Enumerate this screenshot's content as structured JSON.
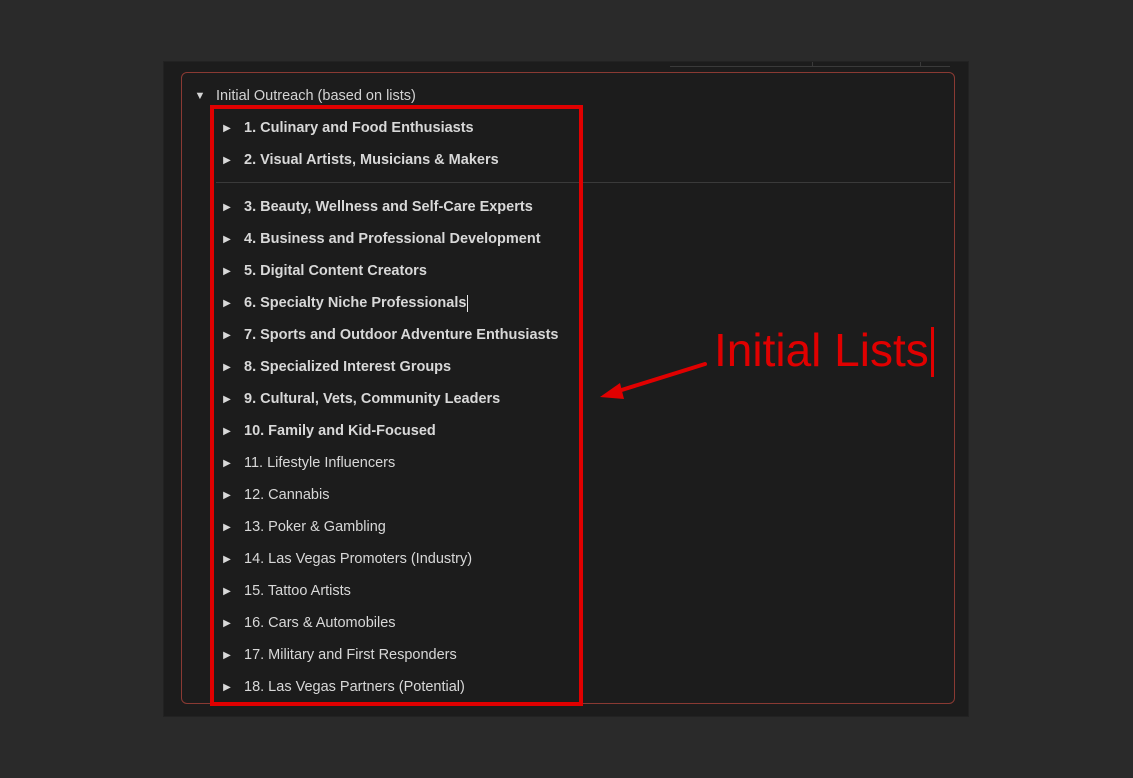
{
  "toggle": {
    "title": "Initial Outreach (based on lists)"
  },
  "lists": [
    {
      "label": "1. Culinary and Food Enthusiasts",
      "bold": true
    },
    {
      "label": "2. Visual Artists, Musicians & Makers",
      "bold": true
    },
    {
      "label": "3. Beauty, Wellness and Self-Care Experts",
      "bold": true
    },
    {
      "label": "4. Business and Professional Development",
      "bold": true
    },
    {
      "label": "5. Digital Content Creators",
      "bold": true
    },
    {
      "label": "6. Specialty Niche Professionals",
      "bold": true
    },
    {
      "label": "7. Sports and Outdoor Adventure Enthusiasts",
      "bold": true
    },
    {
      "label": "8. Specialized Interest Groups",
      "bold": true
    },
    {
      "label": "9. Cultural, Vets, Community Leaders",
      "bold": true
    },
    {
      "label": "10. Family and Kid-Focused",
      "bold": true
    },
    {
      "label": "11. Lifestyle Influencers",
      "bold": false
    },
    {
      "label": "12. Cannabis",
      "bold": false
    },
    {
      "label": "13. Poker & Gambling",
      "bold": false
    },
    {
      "label": "14. Las Vegas Promoters (Industry)",
      "bold": false
    },
    {
      "label": "15. Tattoo Artists",
      "bold": false
    },
    {
      "label": "16. Cars & Automobiles",
      "bold": false
    },
    {
      "label": "17. Military and First Responders",
      "bold": false
    },
    {
      "label": "18. Las Vegas Partners (Potential)",
      "bold": false
    }
  ],
  "annotation": {
    "text": "Initial Lists",
    "color": "#e00000"
  },
  "icons": {
    "expanded": "triangle-down-icon",
    "collapsed": "triangle-right-icon"
  }
}
